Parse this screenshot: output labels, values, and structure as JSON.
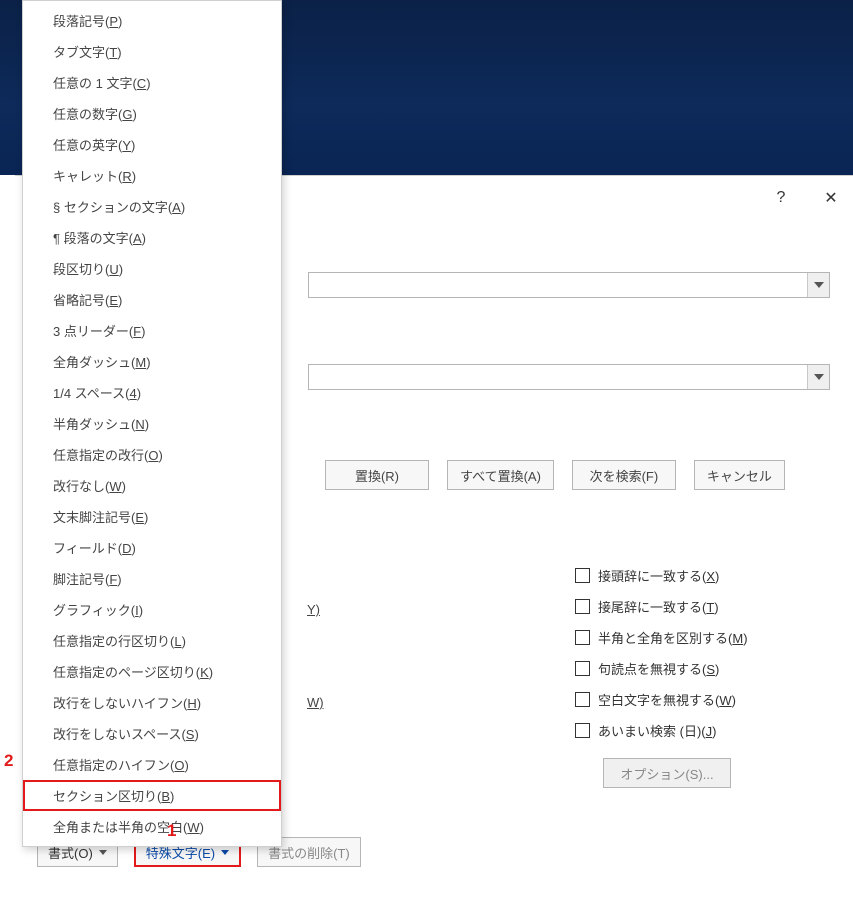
{
  "titlebar": {
    "help": "?",
    "close": "✕"
  },
  "buttons": {
    "replace": "置換(R)",
    "replace_all": "すべて置換(A)",
    "find_next": "次を検索(F)",
    "cancel": "キャンセル",
    "format": "書式(O)",
    "special": "特殊文字(E)",
    "clear_format": "書式の削除(T)",
    "options": "オプション(S)..."
  },
  "partials": {
    "y": "Y)",
    "w": "W)"
  },
  "checks": [
    {
      "pre": "接頭辞に一致する(",
      "u": "X",
      "post": ")"
    },
    {
      "pre": "接尾辞に一致する(",
      "u": "T",
      "post": ")"
    },
    {
      "pre": "半角と全角を区別する(",
      "u": "M",
      "post": ")"
    },
    {
      "pre": "句読点を無視する(",
      "u": "S",
      "post": ")"
    },
    {
      "pre": "空白文字を無視する(",
      "u": "W",
      "post": ")"
    },
    {
      "pre": "あいまい検索 (日)(",
      "u": "J",
      "post": ")"
    }
  ],
  "menu": [
    {
      "pre": "段落記号(",
      "u": "P",
      "post": ")"
    },
    {
      "pre": "タブ文字(",
      "u": "T",
      "post": ")"
    },
    {
      "pre": "任意の 1 文字(",
      "u": "C",
      "post": ")"
    },
    {
      "pre": "任意の数字(",
      "u": "G",
      "post": ")"
    },
    {
      "pre": "任意の英字(",
      "u": "Y",
      "post": ")"
    },
    {
      "pre": "キャレット(",
      "u": "R",
      "post": ")"
    },
    {
      "pre": "§ セクションの文字(",
      "u": "A",
      "post": ")"
    },
    {
      "pre": "¶ 段落の文字(",
      "u": "A",
      "post": ")"
    },
    {
      "pre": "段区切り(",
      "u": "U",
      "post": ")"
    },
    {
      "pre": "省略記号(",
      "u": "E",
      "post": ")"
    },
    {
      "pre": "3 点リーダー(",
      "u": "F",
      "post": ")"
    },
    {
      "pre": "全角ダッシュ(",
      "u": "M",
      "post": ")"
    },
    {
      "pre": "1/4 スペース(",
      "u": "4",
      "post": ")"
    },
    {
      "pre": "半角ダッシュ(",
      "u": "N",
      "post": ")"
    },
    {
      "pre": "任意指定の改行(",
      "u": "O",
      "post": ")"
    },
    {
      "pre": "改行なし(",
      "u": "W",
      "post": ")"
    },
    {
      "pre": "文末脚注記号(",
      "u": "E",
      "post": ")"
    },
    {
      "pre": "フィールド(",
      "u": "D",
      "post": ")"
    },
    {
      "pre": "脚注記号(",
      "u": "F",
      "post": ")"
    },
    {
      "pre": "グラフィック(",
      "u": "I",
      "post": ")"
    },
    {
      "pre": "任意指定の行区切り(",
      "u": "L",
      "post": ")"
    },
    {
      "pre": "任意指定のページ区切り(",
      "u": "K",
      "post": ")"
    },
    {
      "pre": "改行をしないハイフン(",
      "u": "H",
      "post": ")"
    },
    {
      "pre": "改行をしないスペース(",
      "u": "S",
      "post": ")"
    },
    {
      "pre": "任意指定のハイフン(",
      "u": "O",
      "post": ")"
    },
    {
      "pre": "セクション区切り(",
      "u": "B",
      "post": ")"
    },
    {
      "pre": "全角または半角の空白(",
      "u": "W",
      "post": ")"
    }
  ],
  "annotations": {
    "one": "1",
    "two": "2"
  }
}
